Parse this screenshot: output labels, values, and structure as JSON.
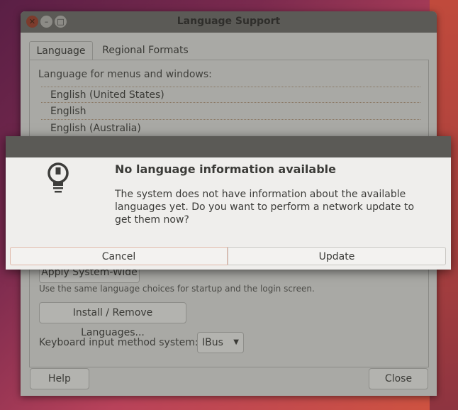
{
  "window": {
    "title": "Language Support",
    "controls": {
      "close": "✕",
      "minimize": "–",
      "maximize": "□"
    }
  },
  "tabs": [
    {
      "label": "Language"
    },
    {
      "label": "Regional Formats"
    }
  ],
  "language_panel": {
    "menus_label": "Language for menus and windows:",
    "languages": [
      "English (United States)",
      "English",
      "English (Australia)"
    ],
    "apply_button_partial": "Apply System-Wide",
    "apply_help": "Use the same language choices for startup and the login screen.",
    "install_button": "Install / Remove Languages...",
    "keyboard_label": "Keyboard input method system:",
    "keyboard_value": "IBus"
  },
  "footer": {
    "help": "Help",
    "close": "Close"
  },
  "dialog": {
    "icon": "lightbulb-icon",
    "title": "No language information available",
    "body": "The system does not have information about the available languages yet. Do you want to perform a network update to get them now?",
    "cancel": "Cancel",
    "update": "Update"
  }
}
